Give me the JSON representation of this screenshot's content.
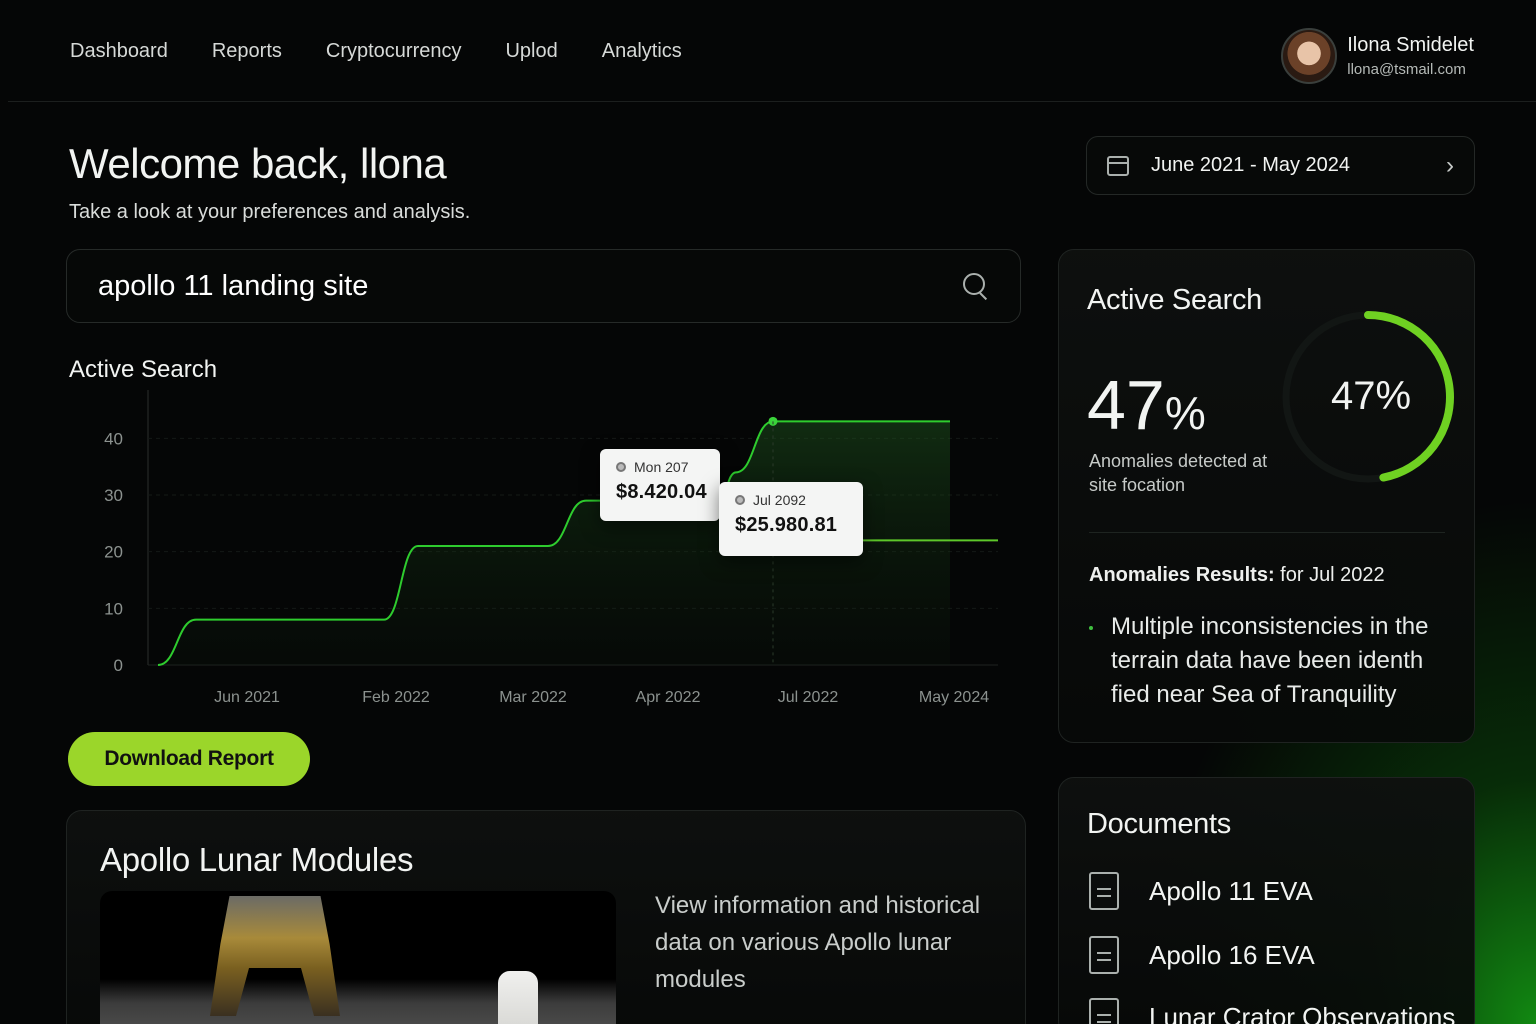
{
  "nav": {
    "items": [
      {
        "label": "Dashboard"
      },
      {
        "label": "Reports"
      },
      {
        "label": "Cryptocurrency"
      },
      {
        "label": "Uplod"
      },
      {
        "label": "Analytics"
      }
    ]
  },
  "profile": {
    "name": "Ilona Smidelet",
    "email": "llona@tsmail.com"
  },
  "header": {
    "welcome": "Welcome back, llona",
    "subtitle": "Take a look at your preferences and analysis.",
    "date_range": "June 2021 - May 2024",
    "icon_calendar": "calendar-icon",
    "icon_next": "chevron-right-icon"
  },
  "search": {
    "value": "apollo 11 landing site",
    "icon": "search-icon"
  },
  "chart_section": {
    "title": "Active Search"
  },
  "chart_data": {
    "type": "line",
    "x": [
      "Jun 2021",
      "Feb 2022",
      "Mar 2022",
      "Apr 2022",
      "Jul 2022",
      "May 2024"
    ],
    "x_ticks": [
      "Jun 2021",
      "Feb 2022",
      "Mar 2022",
      "Apr 2022",
      "Jul 2022",
      "May 2024"
    ],
    "series": [
      {
        "points": [
          {
            "x": "Jun 2021",
            "y": 8
          },
          {
            "x": "Feb 2022",
            "y": 8
          },
          {
            "x": "Feb 2022",
            "y": 21
          },
          {
            "x": "Mar 2022",
            "y": 21
          },
          {
            "x": "Apr 2022",
            "y": 29
          },
          {
            "x": "Apr 2022",
            "y": 34
          },
          {
            "x": "Jul 2022",
            "y": 43
          },
          {
            "x": "May 2024",
            "y": 43
          }
        ],
        "color": "#2ecc2e"
      },
      {
        "points": [
          {
            "x": "Jul 2022",
            "y": 22
          },
          {
            "x": "May 2024",
            "y": 22
          }
        ],
        "color": "#5ec82a"
      }
    ],
    "yticks": [
      0,
      10,
      20,
      30,
      40
    ],
    "ylim": [
      0,
      45
    ],
    "grid": true,
    "tooltips": [
      {
        "date": "Mon 207",
        "value": "$8.420.04"
      },
      {
        "date": "Jul 2092",
        "value": "$25.980.81"
      }
    ]
  },
  "actions": {
    "download_label": "Download Report"
  },
  "modules": {
    "title": "Apollo Lunar Modules",
    "description": "View information and historical data on various Apollo lunar modules"
  },
  "anomalies": {
    "title": "Active Search",
    "percent_value": "47",
    "percent_symbol": "%",
    "gauge_label": "47%",
    "gauge_fraction": 0.47,
    "accent": "#6fd122",
    "label": "Anomalies detected at site focation",
    "results_label": "Anomalies Results:",
    "results_period": " for Jul 2022",
    "results": [
      "Multiple inconsistencies in the terrain data have been identh fied near Sea of Tranquility"
    ]
  },
  "documents": {
    "title": "Documents",
    "items": [
      {
        "label": "Apollo 11 EVA",
        "icon": "document-icon"
      },
      {
        "label": "Apollo 16 EVA",
        "icon": "document-icon"
      },
      {
        "label": "Lunar Crator Observations",
        "icon": "document-icon"
      }
    ]
  }
}
